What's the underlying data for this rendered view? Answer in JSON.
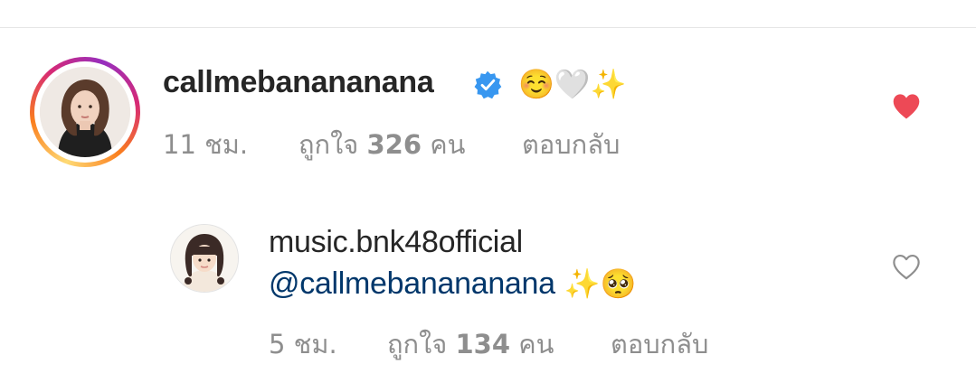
{
  "comment": {
    "username": "callmebanananana",
    "verified": true,
    "text": "☺️🤍✨",
    "time": "11 ชม.",
    "likes_label": "ถูกใจ",
    "likes_count": "326",
    "likes_unit": "คน",
    "reply_label": "ตอบกลับ",
    "liked": true
  },
  "reply": {
    "username": "music.bnk48official",
    "mention": "@callmebanananana",
    "text": "✨🥺",
    "time": "5 ชม.",
    "likes_label": "ถูกใจ",
    "likes_count": "134",
    "likes_unit": "คน",
    "reply_label": "ตอบกลับ",
    "liked": false
  },
  "colors": {
    "accent_link": "#00376b",
    "verified_blue": "#3897f0",
    "heart_red": "#ed4956",
    "meta_gray": "#8e8e8e"
  },
  "icons": {
    "verified": "verified-badge-icon",
    "like_filled": "heart-filled-icon",
    "like_outline": "heart-outline-icon"
  }
}
